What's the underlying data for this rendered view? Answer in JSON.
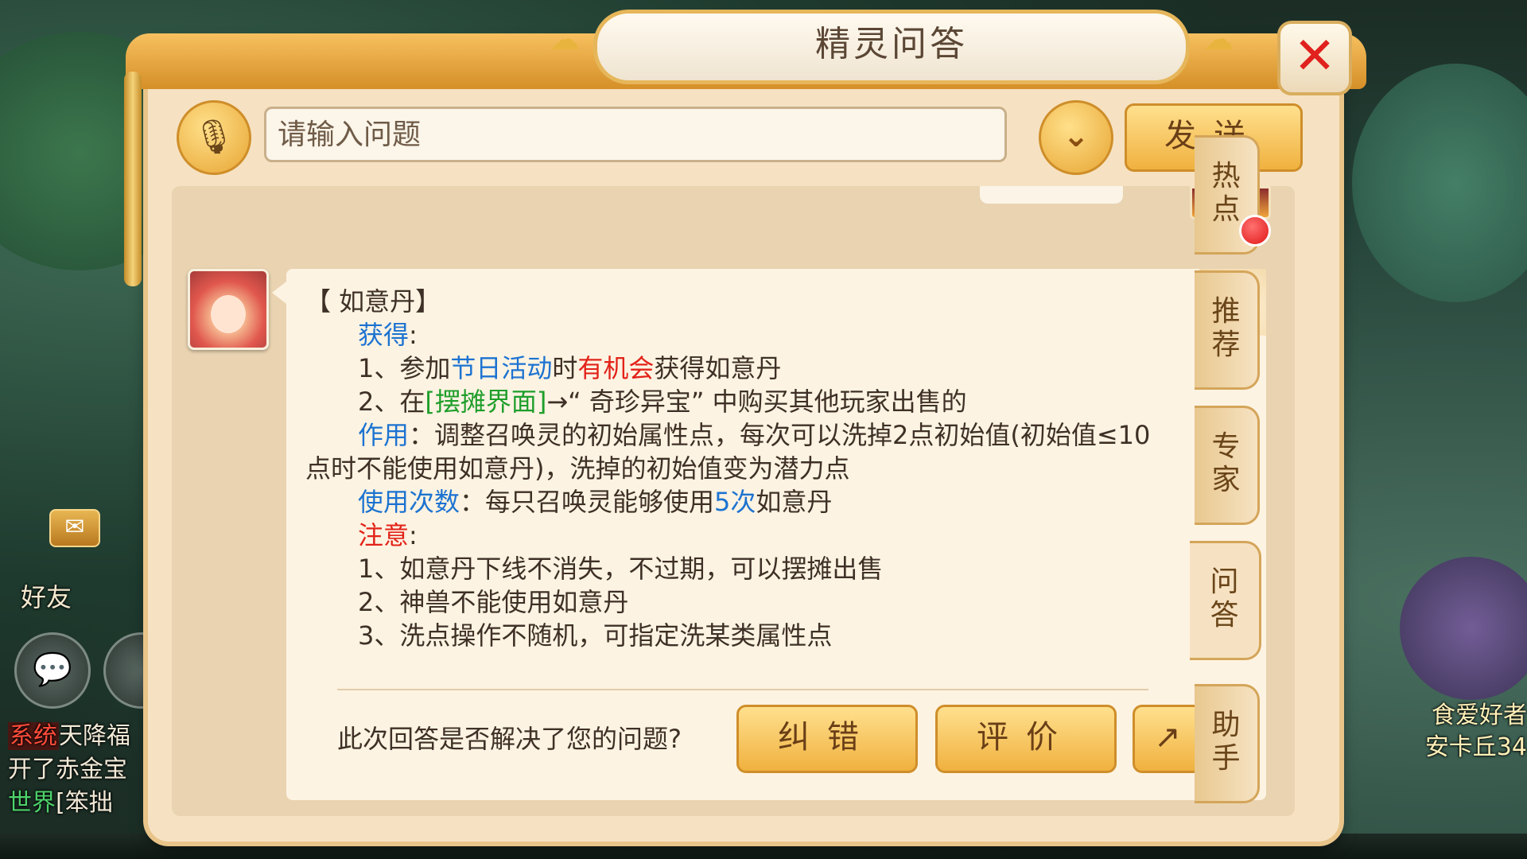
{
  "dialog": {
    "title": "精灵问答",
    "close_icon": "close-icon"
  },
  "input": {
    "placeholder": "请输入问题",
    "send_label": "发送"
  },
  "answer": {
    "heading": "【 如意丹】",
    "obtain_label": "获得",
    "obtain_items": [
      {
        "prefix": "1、参加",
        "highlight1": "节日活动",
        "mid": "时",
        "highlight2": "有机会",
        "suffix": "获得如意丹"
      },
      {
        "prefix": "2、在",
        "highlight": "[摆摊界面]",
        "suffix": "→“ 奇珍异宝” 中购买其他玩家出售的"
      }
    ],
    "effect_label": "作用",
    "effect_text_1": "：调整召唤灵的初始属性点，每次可以洗掉2点初始值(初始值≤10",
    "effect_text_2": "点时不能使用如意丹)，洗掉的初始值变为潜力点",
    "usage_label": "使用次数",
    "usage_prefix": "：每只召唤灵能够使用",
    "usage_count": "5次",
    "usage_suffix": "如意丹",
    "note_label": "注意",
    "notes": [
      "1、如意丹下线不消失，不过期，可以摆摊出售",
      "2、神兽不能使用如意丹",
      "3、洗点操作不随机，可指定洗某类属性点"
    ]
  },
  "feedback": {
    "question": "此次回答是否解决了您的问题?",
    "correct_label": "纠错",
    "rate_label": "评价"
  },
  "tabs": [
    {
      "line1": "热",
      "line2": "点"
    },
    {
      "line1": "推",
      "line2": "荐"
    },
    {
      "line1": "专",
      "line2": "家"
    },
    {
      "line1": "问",
      "line2": "答"
    },
    {
      "line1": "助",
      "line2": "手"
    }
  ],
  "hud": {
    "friend_label": "好友",
    "chat": [
      {
        "channel": "系统",
        "text": "天降福"
      },
      {
        "channel": "",
        "text": "开了赤金宝"
      },
      {
        "channel": "世界",
        "text": "[笨拙"
      }
    ],
    "right_names": [
      "食爱好者",
      "安卡丘34"
    ]
  },
  "colors": {
    "panel": "#f6e2c2",
    "accent_button": "#f0b13f",
    "highlight_blue": "#1c73d1",
    "highlight_red": "#e2231a",
    "highlight_green": "#1e9e2a"
  }
}
